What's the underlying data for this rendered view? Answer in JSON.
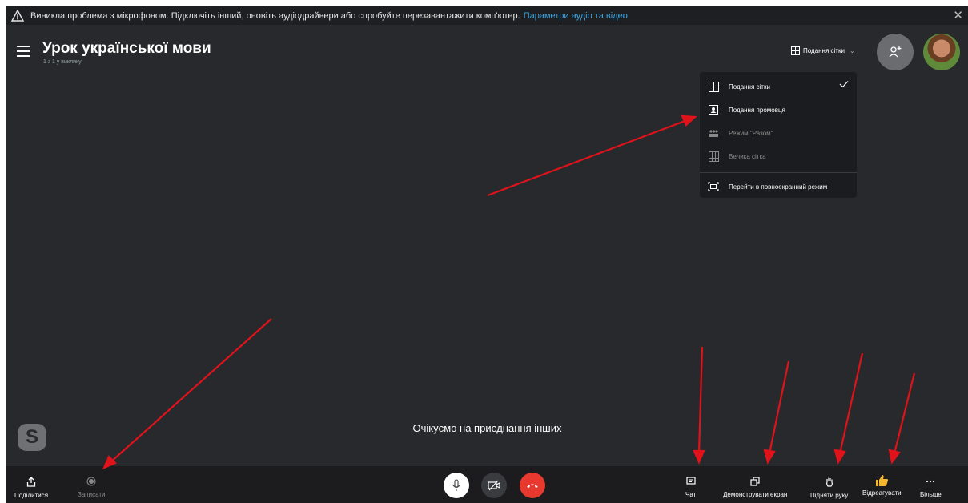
{
  "banner": {
    "message": "Виникла проблема з мікрофоном. Підключіть інший, оновіть аудіодрайвери або спробуйте перезавантажити комп'ютер.",
    "link": "Параметри аудіо та відео",
    "close": "✕"
  },
  "header": {
    "title": "Урок української мови",
    "subtitle": "1 з 1 у виклику",
    "view_button": "Подання сітки"
  },
  "view_menu": {
    "items": [
      {
        "label": "Подання сітки",
        "icon": "grid-icon",
        "checked": true,
        "enabled": true
      },
      {
        "label": "Подання промовця",
        "icon": "speaker-view-icon",
        "checked": false,
        "enabled": true
      },
      {
        "label": "Режим \"Разом\"",
        "icon": "together-mode-icon",
        "checked": false,
        "enabled": false
      },
      {
        "label": "Велика сітка",
        "icon": "large-grid-icon",
        "checked": false,
        "enabled": false
      },
      {
        "label": "Перейти в повноекранний режим",
        "icon": "fullscreen-icon",
        "checked": false,
        "enabled": true
      }
    ]
  },
  "stage": {
    "waiting_text": "Очікуємо на приєднання інших",
    "logo_letter": "S"
  },
  "toolbar": {
    "share": "Поділитися",
    "record": "Записати",
    "chat": "Чат",
    "screen_share": "Демонструвати екран",
    "raise_hand": "Підняти руку",
    "react": "Відреагувати",
    "more": "Більше"
  },
  "colors": {
    "background": "#28292d",
    "end_call": "#e8392f",
    "link": "#38a7e8",
    "annotation_arrow": "#e0121a",
    "reaction": "#f5b82e"
  }
}
